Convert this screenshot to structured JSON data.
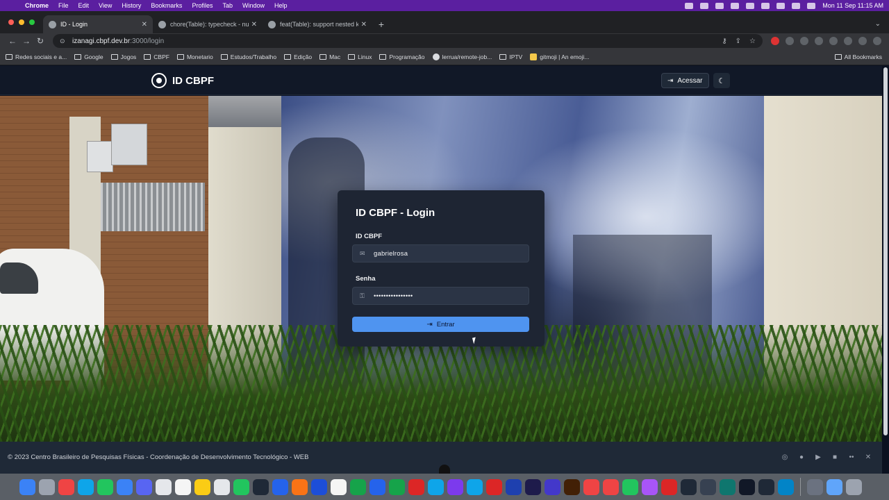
{
  "menubar": {
    "app_name": "Chrome",
    "items": [
      "File",
      "Edit",
      "View",
      "History",
      "Bookmarks",
      "Profiles",
      "Tab",
      "Window",
      "Help"
    ],
    "clock": "Mon 11 Sep  11:15 AM"
  },
  "browser": {
    "tabs": [
      {
        "title": "ID - Login",
        "active": true
      },
      {
        "title": "chore(Table): typecheck - nuxt",
        "active": false
      },
      {
        "title": "feat(Table): support nested key",
        "active": false
      }
    ],
    "address": {
      "host": "izanagi.cbpf.dev.br",
      "path": ":3000/login"
    },
    "bookmarks": [
      {
        "label": "Redes sociais e a...",
        "type": "folder"
      },
      {
        "label": "Google",
        "type": "folder"
      },
      {
        "label": "Jogos",
        "type": "folder"
      },
      {
        "label": "CBPF",
        "type": "folder"
      },
      {
        "label": "Monetario",
        "type": "folder"
      },
      {
        "label": "Estudos/Trabalho",
        "type": "folder"
      },
      {
        "label": "Edição",
        "type": "folder"
      },
      {
        "label": "Mac",
        "type": "folder"
      },
      {
        "label": "Linux",
        "type": "folder"
      },
      {
        "label": "Programação",
        "type": "folder"
      },
      {
        "label": "lerrua/remote-job...",
        "type": "github"
      },
      {
        "label": "IPTV",
        "type": "folder"
      },
      {
        "label": "gitmoji | An emoji...",
        "type": "emoji"
      }
    ],
    "all_bookmarks": "All Bookmarks"
  },
  "header": {
    "brand": "ID CBPF",
    "login_button": "Acessar"
  },
  "login": {
    "title": "ID CBPF - Login",
    "username_label": "ID CBPF",
    "username_value": "gabrielrosa",
    "password_label": "Senha",
    "password_value": "••••••••••••••••",
    "submit_label": "Entrar"
  },
  "footer": {
    "copyright": "© 2023 Centro Brasileiro de Pesquisas Físicas - Coordenação de Desenvolvimento Tecnológico - WEB",
    "social": [
      "instagram-icon",
      "facebook-icon",
      "youtube-icon",
      "linkedin-icon",
      "flickr-icon",
      "x-icon"
    ]
  },
  "colors": {
    "accent_button": "#4f94f0",
    "card_bg": "#1e2533",
    "header_bg": "#111827",
    "menubar_bg": "#5b1fa0"
  },
  "dock_apps": [
    "#3b82f6",
    "#9ca3af",
    "#ef4444",
    "#0ea5e9",
    "#22c55e",
    "#3b82f6",
    "#5865f2",
    "#e5e7eb",
    "#f5f5f5",
    "#facc15",
    "#e5e7eb",
    "#22c55e",
    "#1f2937",
    "#2563eb",
    "#f97316",
    "#1d4ed8",
    "#f5f5f5",
    "#16a34a",
    "#2563eb",
    "#16a34a",
    "#dc2626",
    "#0ea5e9",
    "#7c3aed",
    "#0ea5e9",
    "#dc2626",
    "#1e40af",
    "#1e1b4b",
    "#4338ca",
    "#422006",
    "#ef4444",
    "#ef4444",
    "#22c55e",
    "#a855f7",
    "#dc2626",
    "#1f2937",
    "#374151",
    "#0f766e",
    "#111827",
    "#1f2937",
    "#0284c7",
    "#6b7280",
    "#60a5fa",
    "#9ca3af"
  ]
}
